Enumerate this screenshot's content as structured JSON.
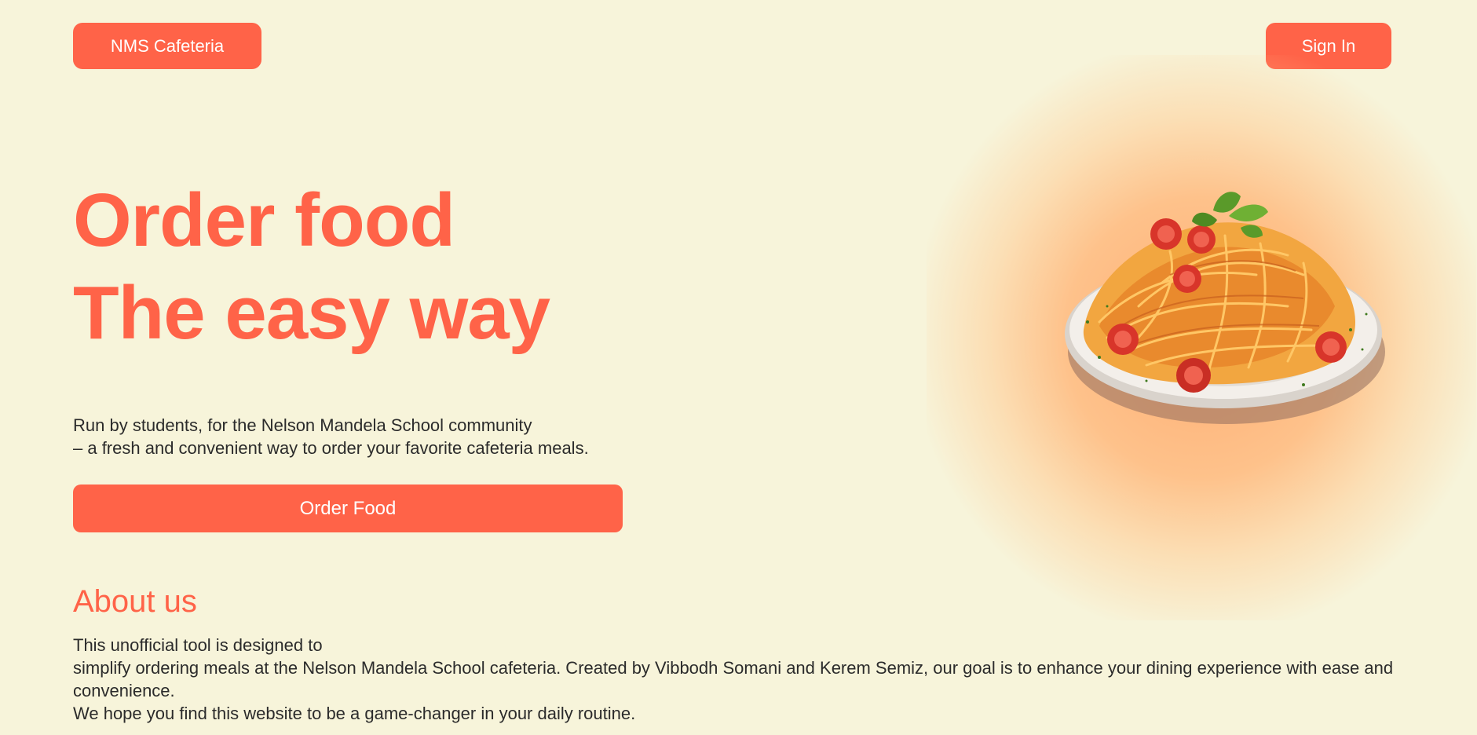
{
  "header": {
    "brand_label": "NMS Cafeteria",
    "signin_label": "Sign In"
  },
  "hero": {
    "title_line1": "Order food",
    "title_line2": "The easy way",
    "subtitle_line1": "Run by students, for the Nelson Mandela School community",
    "subtitle_line2": "– a fresh and convenient way to order your favorite cafeteria meals.",
    "order_button_label": "Order Food",
    "image_alt": "spaghetti-plate"
  },
  "about": {
    "title": "About us",
    "line1": "This unofficial tool is designed to",
    "line2": "simplify ordering meals at the Nelson Mandela School cafeteria. Created by Vibbodh Somani and Kerem Semiz, our goal is to enhance your dining experience with ease and convenience.",
    "line3": "We hope you find this website to be a game-changer in your daily routine."
  },
  "colors": {
    "accent": "#ff6348",
    "background": "#f7f4da",
    "text": "#2b2b2b"
  }
}
